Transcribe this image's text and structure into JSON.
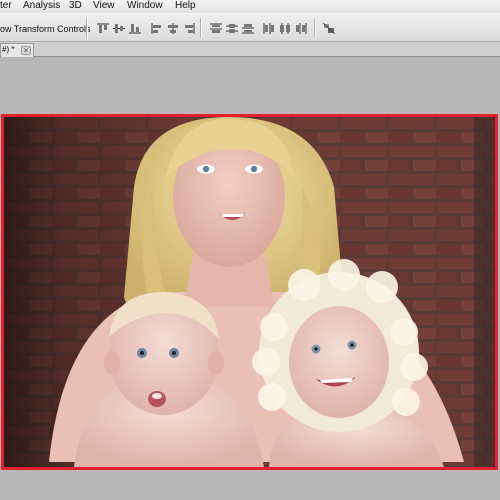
{
  "menubar": {
    "items": [
      {
        "label": "ter"
      },
      {
        "label": "Analysis"
      },
      {
        "label": "3D"
      },
      {
        "label": "View"
      },
      {
        "label": "Window"
      },
      {
        "label": "Help"
      }
    ]
  },
  "options_bar": {
    "transform_controls_label": "ow Transform Controls"
  },
  "document_tab": {
    "title": "#) *",
    "close_glyph": "×"
  },
  "canvas": {
    "selection_color": "#e8202c"
  }
}
